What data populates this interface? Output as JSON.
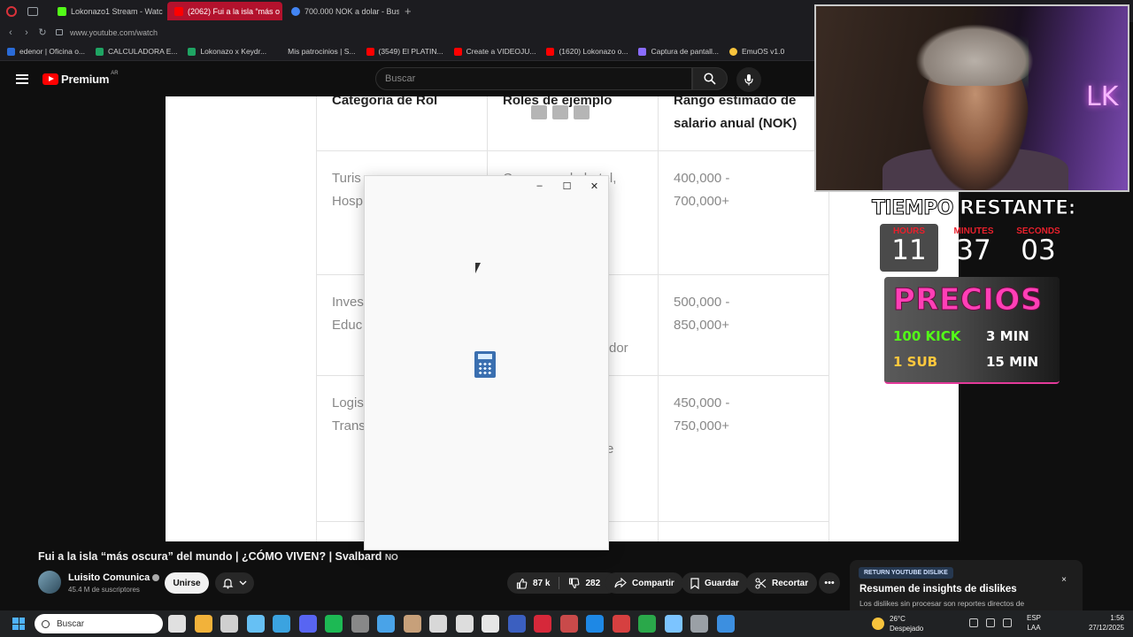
{
  "browser": {
    "tabs": [
      {
        "label": "Lokonazo1 Stream - Watc",
        "color": "#53fc18",
        "active": false
      },
      {
        "label": "(2062) Fui a la isla “más o",
        "color": "#ff0000",
        "active": true
      },
      {
        "label": "700.000 NOK a dolar - Bus",
        "color": "#4285f4",
        "active": false
      }
    ],
    "new_tab": "+",
    "url": "www.youtube.com/watch",
    "bookmarks": [
      {
        "label": "edenor | Oficina o...",
        "color": "#2a6bd8"
      },
      {
        "label": "CALCULADORA E...",
        "color": "#1fa463"
      },
      {
        "label": "Lokonazo x Keydr...",
        "color": "#1fa463"
      },
      {
        "label": "Mis patrocinios | S...",
        "color": "#1c1c20"
      },
      {
        "label": "(3549) El PLATIN...",
        "color": "#ff0000"
      },
      {
        "label": "Create a VIDEOJU...",
        "color": "#ff0000"
      },
      {
        "label": "(1620) Lokonazo o...",
        "color": "#ff0000"
      },
      {
        "label": "Captura de pantall...",
        "color": "#8a6cff"
      },
      {
        "label": "EmuOS v1.0",
        "color": "#f7c33c"
      }
    ]
  },
  "youtube": {
    "logo_text": "Premium",
    "country": "AR",
    "search_placeholder": "Buscar"
  },
  "video_frame": {
    "headers": [
      "Categoría de Rol",
      "Roles de ejemplo",
      "Rango estimado de",
      "salario anual (NOK)"
    ],
    "rows": [
      {
        "category": [
          "Turis",
          "Hosp"
        ],
        "roles": [
          "Camarero de hotel,"
        ],
        "range": [
          "400,000 -",
          "700,000+"
        ]
      },
      {
        "category": [
          "Inves",
          "Educ"
        ],
        "roles": [
          "dor"
        ],
        "range": [
          "500,000 -",
          "850,000+"
        ]
      },
      {
        "category": [
          "Logis",
          "Trans"
        ],
        "roles": [
          "e"
        ],
        "range": [
          "450,000 -",
          "750,000+"
        ]
      }
    ]
  },
  "calculator_window": {
    "minimize": "–",
    "maximize": "☐",
    "close": "✕"
  },
  "video_info": {
    "title": "Fui a la isla “más oscura” del mundo | ¿CÓMO VIVEN? | Svalbard",
    "title_suffix": "NO",
    "channel_name": "Luisito Comunica",
    "subscribers": "45.4 M de suscriptores",
    "join_label": "Unirse",
    "likes": "87 k",
    "dislikes": "282",
    "share_label": "Compartir",
    "save_label": "Guardar",
    "clip_label": "Recortar",
    "more_label": "•••"
  },
  "ryd_panel": {
    "badge": "RETURN YOUTUBE DISLIKE",
    "title": "Resumen de insights de dislikes",
    "description": "Los dislikes sin procesar son reportes directos de",
    "close": "×"
  },
  "stream_overlay": {
    "timer_title": "TIEMPO RESTANTE:",
    "timer": [
      {
        "label": "HOURS",
        "value": "11"
      },
      {
        "label": "MINUTES",
        "value": "37"
      },
      {
        "label": "SECONDS",
        "value": "03"
      }
    ],
    "precios_title": "PRECIOS",
    "precios": [
      {
        "item": "100 KICK",
        "time": "3 MIN"
      },
      {
        "item": "1 SUB",
        "time": "15 MIN"
      }
    ],
    "neon_sign": "LK"
  },
  "taskbar": {
    "search_placeholder": "Buscar",
    "weather_temp": "26°C",
    "weather_desc": "Despejado",
    "lang_top": "ESP",
    "lang_bottom": "LAA",
    "time": "1:56",
    "date": "27/12/2025",
    "apps": [
      "#e0e0e0",
      "#f2b23a",
      "#cfcfcf",
      "#66c0f4",
      "#3ba3e0",
      "#5865f2",
      "#1db954",
      "#888888",
      "#49a3e8",
      "#c7a07a",
      "#d8d8d8",
      "#dddddd",
      "#e6e6e6",
      "#3b5fc0",
      "#d6283a",
      "#c94a4a",
      "#1e88e5",
      "#d64040",
      "#2aa84a",
      "#7cc4ff",
      "#9aa0a6",
      "#3c8fe0"
    ]
  }
}
